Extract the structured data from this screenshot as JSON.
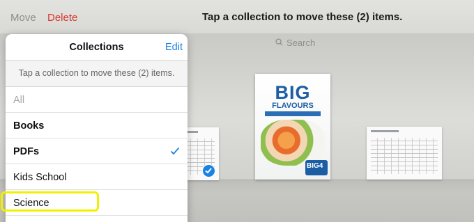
{
  "toolbar": {
    "move_label": "Move",
    "delete_label": "Delete",
    "title": "Tap a collection to move these (2) items."
  },
  "search": {
    "placeholder": "Search"
  },
  "popover": {
    "title": "Collections",
    "edit_label": "Edit",
    "hint": "Tap a collection to move these (2) items.",
    "items": [
      {
        "label": "All",
        "state": "disabled"
      },
      {
        "label": "Books",
        "state": "normal"
      },
      {
        "label": "PDFs",
        "state": "selected"
      },
      {
        "label": "Kids School",
        "state": "normal"
      },
      {
        "label": "Science",
        "state": "highlighted"
      }
    ]
  },
  "shelf": {
    "cover": {
      "title": "BIG",
      "subtitle": "FLAVOURS",
      "logo": "BIG4"
    }
  },
  "colors": {
    "accent": "#1a82e2",
    "delete": "#d9352e",
    "highlight": "#f2f000"
  }
}
